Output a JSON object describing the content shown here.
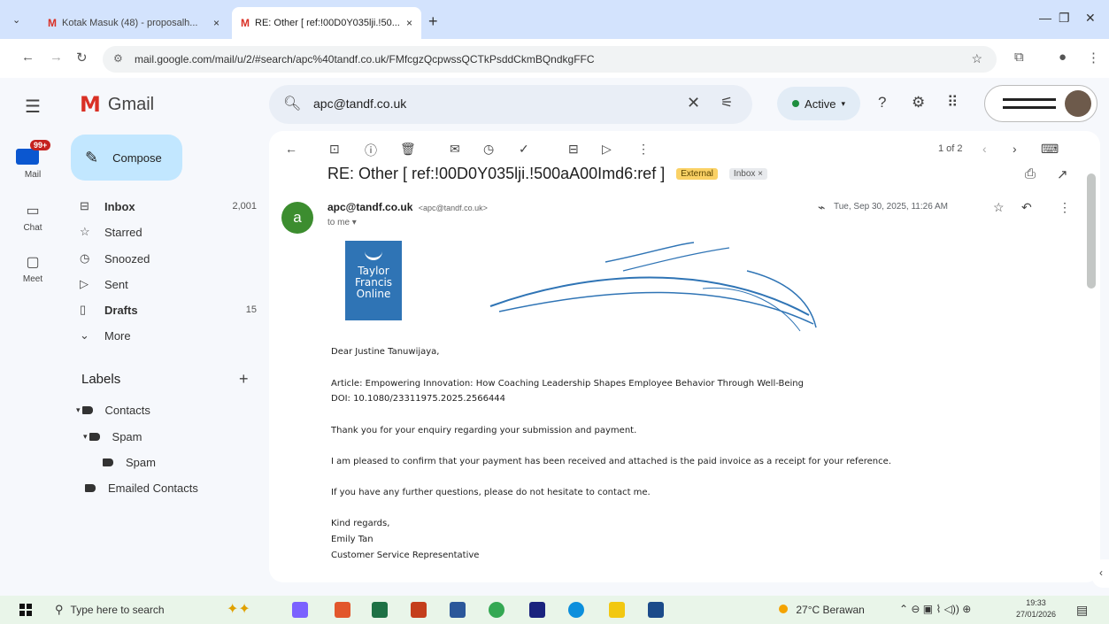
{
  "browser": {
    "tabs": [
      {
        "label": "Kotak Masuk (48) - proposalh...",
        "close": "×"
      },
      {
        "label": "RE: Other [ ref:!00D0Y035lji.!50...",
        "close": "×"
      }
    ],
    "new_tab": "+",
    "url": "mail.google.com/mail/u/2/#search/apc%40tandf.co.uk/FMfcgzQcpwssQCTkPsddCkmBQndkgFFC"
  },
  "gmail": {
    "product_name": "Gmail",
    "search_value": "apc@tandf.co.uk",
    "status": "Active",
    "rail": {
      "mail": "Mail",
      "chat": "Chat",
      "meet": "Meet",
      "mail_badge": "99+"
    },
    "compose_label": "Compose",
    "nav": [
      {
        "label": "Inbox",
        "count": "2,001"
      },
      {
        "label": "Starred",
        "count": ""
      },
      {
        "label": "Snoozed",
        "count": ""
      },
      {
        "label": "Sent",
        "count": ""
      },
      {
        "label": "Drafts",
        "count": "15"
      },
      {
        "label": "More",
        "count": ""
      }
    ],
    "labels_title": "Labels",
    "labels": [
      "Contacts",
      "Spam",
      "Spam",
      "Emailed Contacts"
    ]
  },
  "message": {
    "pager": "1 of 2",
    "subject": "RE: Other [ ref:!00D0Y035lji.!500aA00Imd6:ref ]",
    "chip_external": "External",
    "chip_inbox": "Inbox ×",
    "sender_initial": "a",
    "sender_name": "apc@tandf.co.uk",
    "sender_email": "<apc@tandf.co.uk>",
    "to": "to me ▾",
    "date": "Tue, Sep 30, 2025, 11:26 AM",
    "logo_text": [
      "Taylor",
      "Francis",
      "Online"
    ],
    "body": [
      "Dear Justine Tanuwijaya,",
      "Article: Empowering Innovation: How Coaching Leadership  Shapes Employee Behavior Through Well-Being",
      "DOI: 10.1080/23311975.2025.2566444",
      "Thank you for your enquiry regarding your submission and payment.",
      "I am pleased to confirm that your payment has been received and attached is the paid invoice as a receipt for your reference.",
      "If you have any further questions, please do not hesitate to contact me.",
      "Kind regards,",
      "Emily Tan",
      "Customer Service Representative"
    ]
  },
  "taskbar": {
    "search_placeholder": "Type here to search",
    "weather": "27°C  Berawan",
    "time": "19:33",
    "date": "27/01/2026"
  },
  "colors": {
    "compose": "#c2e7ff",
    "logo": "#2f74b5",
    "external_chip": "#fad165"
  }
}
